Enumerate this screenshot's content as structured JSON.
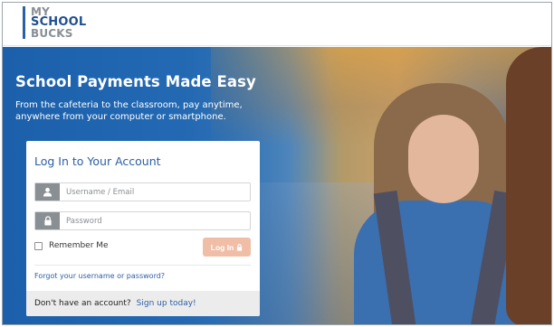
{
  "logo": {
    "line1": "MY",
    "line2": "SCHOOL",
    "line3": "BUCKS"
  },
  "hero": {
    "title": "School Payments Made Easy",
    "subtitle": "From the cafeteria to the classroom, pay anytime, anywhere from your computer or smartphone."
  },
  "login": {
    "title": "Log In to Your Account",
    "username_placeholder": "Username / Email",
    "password_placeholder": "Password",
    "remember_label": "Remember Me",
    "login_button": "Log In",
    "forgot_link": "Forgot your username or password?",
    "no_account_text": "Don't have an account?",
    "signup_link": "Sign up today!"
  },
  "icons": {
    "username": "user-icon",
    "password": "lock-icon",
    "login_button": "lock-icon"
  },
  "colors": {
    "brand_blue": "#2c5fa3",
    "hero_blue": "#1c63ad",
    "login_button": "#f0bea6",
    "footer_bg": "#ececec"
  }
}
